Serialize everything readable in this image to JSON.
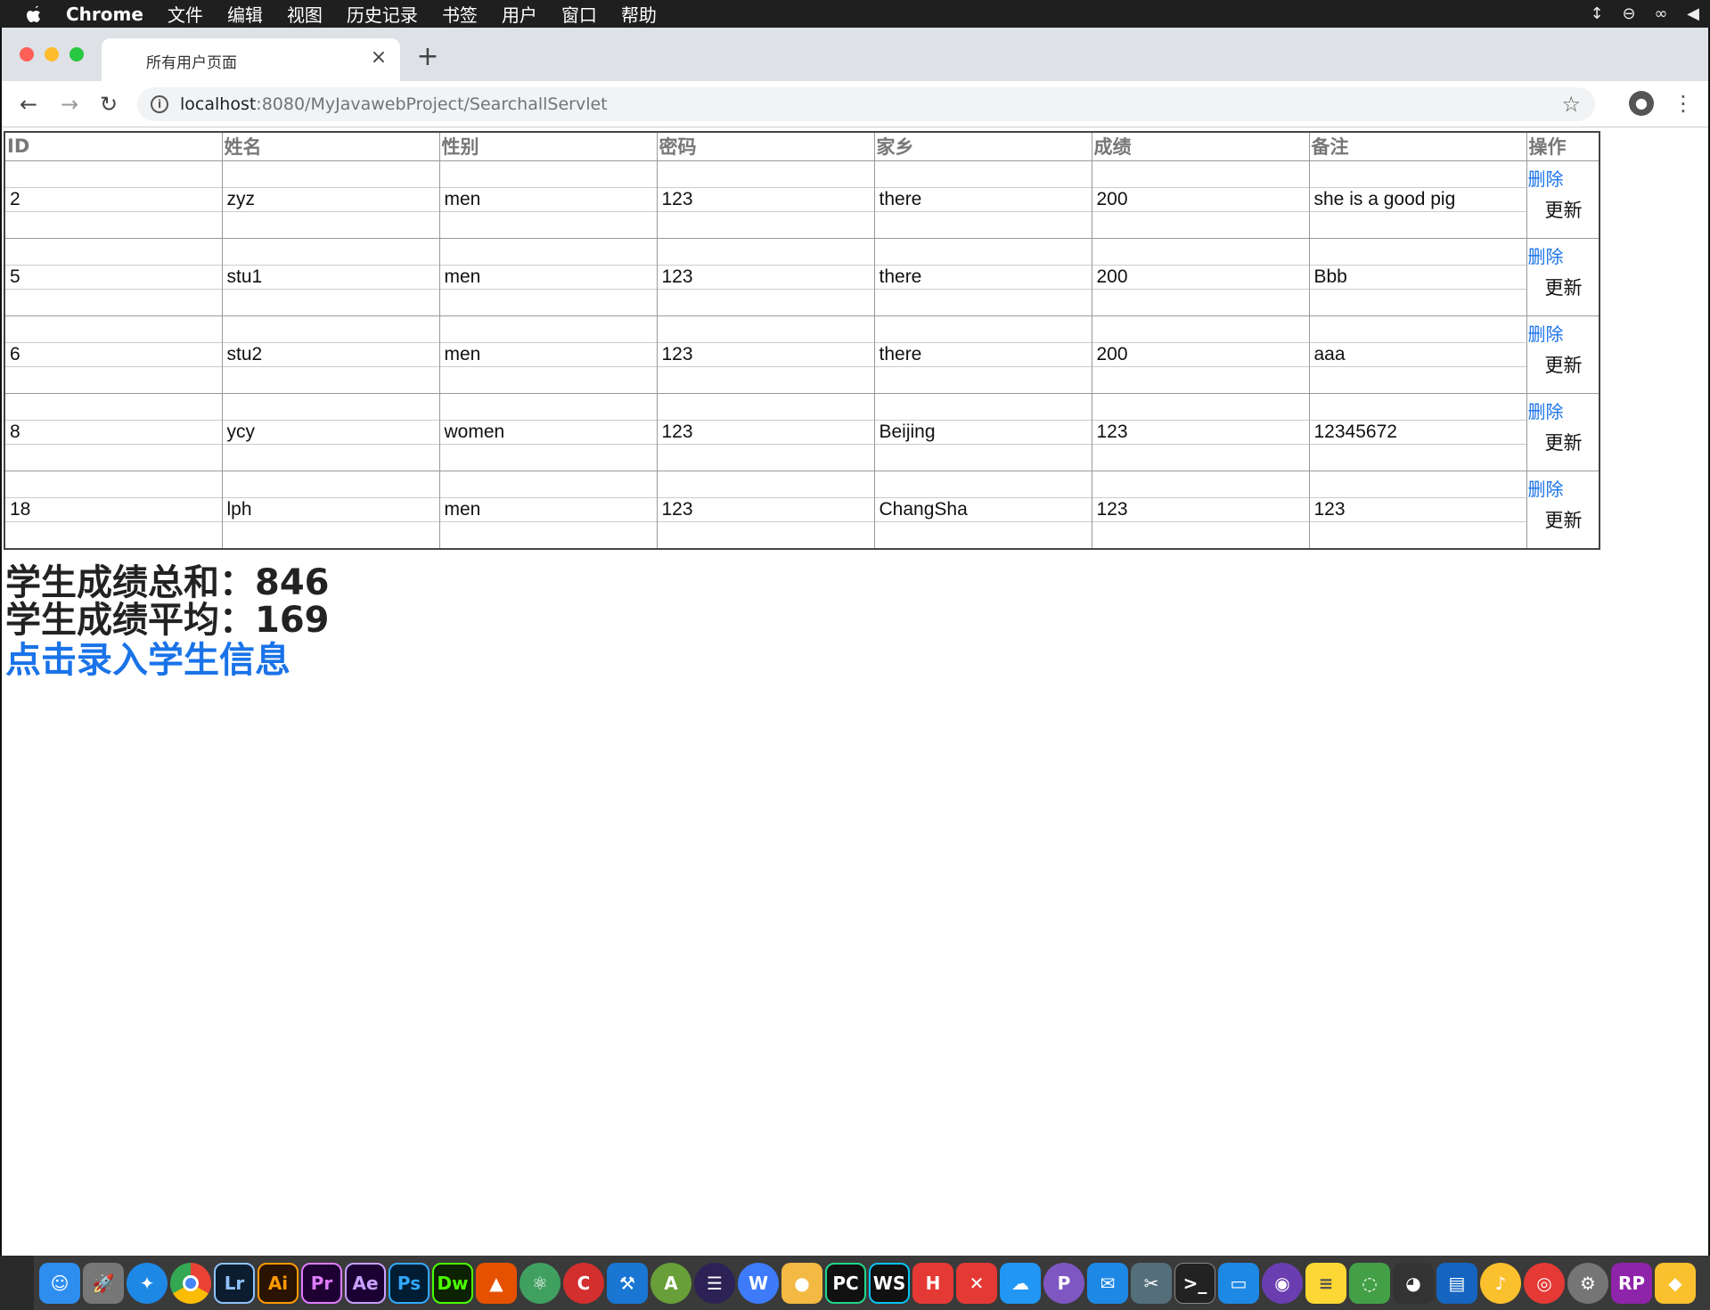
{
  "menubar": {
    "app": "Chrome",
    "items": [
      "文件",
      "编辑",
      "视图",
      "历史记录",
      "书签",
      "用户",
      "窗口",
      "帮助"
    ]
  },
  "browser": {
    "tab_title": "所有用户页面",
    "url_host": "localhost",
    "url_rest": ":8080/MyJavawebProject/SearchallServlet"
  },
  "table": {
    "headers": [
      "ID",
      "姓名",
      "性别",
      "密码",
      "家乡",
      "成绩",
      "备注",
      "操作"
    ],
    "rows": [
      {
        "id": "2",
        "name": "zyz",
        "gender": "men",
        "password": "123",
        "hometown": "there",
        "score": "200",
        "note": "she is a good pig"
      },
      {
        "id": "5",
        "name": "stu1",
        "gender": "men",
        "password": "123",
        "hometown": "there",
        "score": "200",
        "note": "Bbb"
      },
      {
        "id": "6",
        "name": "stu2",
        "gender": "men",
        "password": "123",
        "hometown": "there",
        "score": "200",
        "note": "aaa"
      },
      {
        "id": "8",
        "name": "ycy",
        "gender": "women",
        "password": "123",
        "hometown": "Beijing",
        "score": "123",
        "note": "12345672"
      },
      {
        "id": "18",
        "name": "lph",
        "gender": "men",
        "password": "123",
        "hometown": "ChangSha",
        "score": "123",
        "note": "123"
      }
    ],
    "delete_label": "删除",
    "update_label": "更新"
  },
  "summary": {
    "total_label": "学生成绩总和：846",
    "average_label": "学生成绩平均：169",
    "add_link": "点击录入学生信息"
  },
  "dock": {
    "icons": [
      "finder-icon",
      "launchpad-icon",
      "safari-icon",
      "chrome-icon",
      "lightroom-icon",
      "illustrator-icon",
      "premiere-icon",
      "after-effects-icon",
      "photoshop-icon",
      "dreamweaver-icon",
      "matlab-icon",
      "atom-icon",
      "codeblocks-icon",
      "xcode-icon",
      "android-studio-icon",
      "eclipse-icon",
      "wps-icon",
      "folder-icon",
      "pycharm-icon",
      "webstorm-icon",
      "hbuilder-icon",
      "xmind-icon",
      "baidu-netdisk-icon",
      "postman-icon",
      "mail-icon",
      "instruments-icon",
      "terminal-icon",
      "keynote-icon",
      "github-icon",
      "notes-icon",
      "wechat-icon",
      "qq-icon",
      "remote-desktop-icon",
      "qq-music-icon",
      "netease-music-icon",
      "system-preferences-icon",
      "axure-icon",
      "sketch-icon"
    ],
    "labels": {
      "lightroom": "Lr",
      "illustrator": "Ai",
      "premiere": "Pr",
      "after_effects": "Ae",
      "photoshop": "Ps",
      "dreamweaver": "Dw",
      "pycharm": "PC",
      "webstorm": "WS",
      "hbuilder": "H",
      "axure": "RP"
    }
  }
}
